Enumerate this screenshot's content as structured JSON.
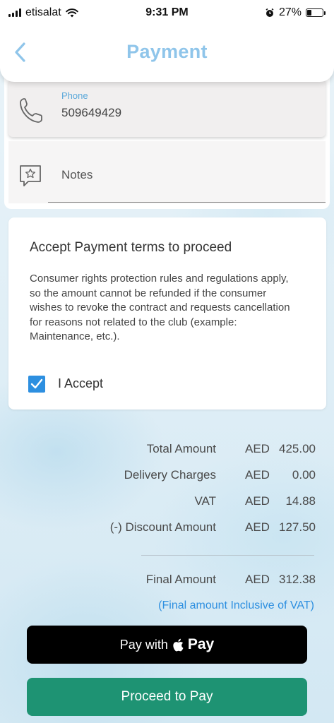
{
  "status_bar": {
    "carrier": "etisalat",
    "time": "9:31 PM",
    "battery_percent": "27%",
    "battery_level": 0.27,
    "icons": [
      "signal-icon",
      "wifi-icon",
      "alarm-icon",
      "battery-icon"
    ]
  },
  "header": {
    "title": "Payment",
    "back_icon": "chevron-left-icon"
  },
  "contact": {
    "phone_label": "Phone",
    "phone_value": "509649429",
    "notes_label": "Notes"
  },
  "terms": {
    "title": "Accept Payment terms to proceed",
    "body": "Consumer rights protection rules and regulations apply, so the amount cannot be refunded if the consumer wishes to revoke the contract and requests cancellation for reasons not related to the club (example: Maintenance, etc.).",
    "accept_label": "I Accept",
    "accept_checked": true
  },
  "summary": {
    "rows": [
      {
        "label": "Total Amount",
        "currency": "AED",
        "amount": "425.00"
      },
      {
        "label": "Delivery Charges",
        "currency": "AED",
        "amount": "0.00"
      },
      {
        "label": "VAT",
        "currency": "AED",
        "amount": "14.88"
      },
      {
        "label": "(-) Discount Amount",
        "currency": "AED",
        "amount": "127.50"
      }
    ],
    "final": {
      "label": "Final Amount",
      "currency": "AED",
      "amount": "312.38"
    },
    "vat_note": "(Final amount Inclusive of VAT)"
  },
  "buttons": {
    "apple_pay_prefix": "Pay with",
    "apple_pay_word": "Pay",
    "proceed": "Proceed to Pay"
  },
  "colors": {
    "title": "#8fc5ea",
    "accent_blue": "#2d8fe0",
    "proceed_green": "#1e9373",
    "apple_pay_black": "#000000"
  }
}
